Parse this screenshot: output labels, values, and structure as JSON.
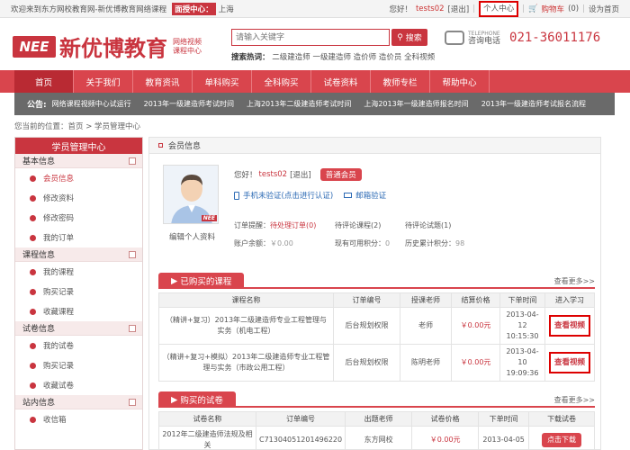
{
  "topbar": {
    "welcome": "欢迎来到东方网校教育网-新优博教育网络课程",
    "city_label": "面授中心：",
    "city": "上海",
    "greeting": "您好！",
    "username": "tests02",
    "logout": "[退出]",
    "personal_center": "个人中心",
    "cart": "购物车",
    "cart_count": "(0)",
    "set_home": "设为首页"
  },
  "header": {
    "logo_nee": "NEE",
    "logo_text": "新优博教育",
    "logo_sub": "网络视频课程中心",
    "search_placeholder": "请输入关键字",
    "search_button": "搜索",
    "hot_label": "搜索热词：",
    "hot_words": [
      "二级建造师",
      "一级建造师",
      "造价师",
      "造价员",
      "全科视频"
    ],
    "phone_en": "TELEPHONE",
    "phone_cn": "咨询电话",
    "phone_number": "021-36011176"
  },
  "nav": [
    "首页",
    "关于我们",
    "教育资讯",
    "单科购买",
    "全科购买",
    "试卷资料",
    "教师专栏",
    "帮助中心"
  ],
  "notice": {
    "label": "公告:",
    "items": [
      "网络课程视频中心试运行",
      "2013年一级建造师考试时间",
      "上海2013年二级建造师考试时间",
      "上海2013年一级建造师报名时间",
      "2013年一级建造师考试报名流程"
    ]
  },
  "breadcrumb": "您当前的位置：首页 > 学员管理中心",
  "sidebar": {
    "title": "学员管理中心",
    "sections": [
      {
        "name": "基本信息",
        "items": [
          "会员信息",
          "修改资料",
          "修改密码",
          "我的订单"
        ]
      },
      {
        "name": "课程信息",
        "items": [
          "我的课程",
          "购买记录",
          "收藏课程"
        ]
      },
      {
        "name": "试卷信息",
        "items": [
          "我的试卷",
          "购买记录",
          "收藏试卷"
        ]
      },
      {
        "name": "站内信息",
        "items": [
          "收信箱"
        ]
      }
    ]
  },
  "main": {
    "title": "会员信息",
    "edit_avatar": "编辑个人资料",
    "greeting": "您好！",
    "username": "tests02",
    "logout": "[退出]",
    "member_level": "普通会员",
    "phone_verify": "手机未验证(点击进行认证)",
    "email_verify": "邮箱验证",
    "stats": {
      "order_reminder": "订单提醒：",
      "pending_orders": "待处理订单(0)",
      "pending_course_review": "待评论课程(2)",
      "pending_review": "待评论试题(1)",
      "balance_label": "账户余额：",
      "balance": "￥0.00",
      "points_label": "现有可用积分：",
      "points": "0",
      "history_label": "历史累计积分：",
      "history": "98"
    }
  },
  "courses": {
    "title": "已购买的课程",
    "more": "查看更多>>",
    "headers": [
      "课程名称",
      "订单编号",
      "授课老师",
      "结算价格",
      "下单时间",
      "进入学习"
    ],
    "rows": [
      {
        "name": "（精讲+复习）2013年二级建造师专业工程管理与实务（机电工程）",
        "order": "后台规划权限",
        "teacher": "老师",
        "price": "￥0.00元",
        "time": "2013-04-12 10:15:30",
        "action": "查看视频"
      },
      {
        "name": "（精讲+复习+模拟）2013年二级建造师专业工程管理与实务（市政公用工程）",
        "order": "后台规划权限",
        "teacher": "陈明老师",
        "price": "￥0.00元",
        "time": "2013-04-10 19:09:36",
        "action": "查看视频"
      }
    ]
  },
  "papers": {
    "title": "购买的试卷",
    "more": "查看更多>>",
    "headers": [
      "试卷名称",
      "订单编号",
      "出题老师",
      "试卷价格",
      "下单时间",
      "下载试卷"
    ],
    "rows": [
      {
        "name": "2012年二级建造师法规及相关",
        "order": "C71304051201496220",
        "teacher": "东方网校",
        "price": "￥0.00元",
        "time": "2013-04-05",
        "action": "点击下载"
      }
    ]
  },
  "colors": {
    "brand_red": "#c9353f",
    "nav_red": "#d9454d",
    "notice_gray": "#6a6a6a"
  }
}
